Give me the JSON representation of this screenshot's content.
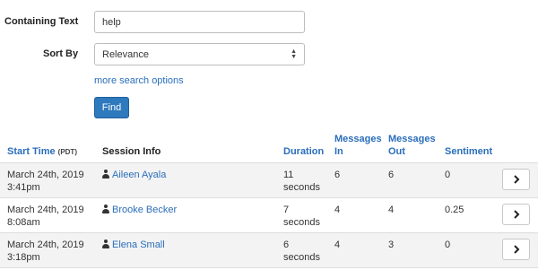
{
  "search": {
    "containing_text_label": "Containing Text",
    "containing_text_value": "help",
    "sort_by_label": "Sort By",
    "sort_by_value": "Relevance",
    "more_options_link": "more search options",
    "find_button": "Find"
  },
  "table": {
    "headers": {
      "start_time": "Start Time",
      "start_time_tz": "(PDT)",
      "session_info": "Session Info",
      "duration": "Duration",
      "messages_in_1": "Messages",
      "messages_in_2": "In",
      "messages_out_1": "Messages",
      "messages_out_2": "Out",
      "sentiment": "Sentiment"
    },
    "rows": [
      {
        "date": "March 24th, 2019",
        "time": "3:41pm",
        "user": "Aileen Ayala",
        "duration_num": "11",
        "duration_unit": "seconds",
        "messages_in": "6",
        "messages_out": "6",
        "sentiment": "0"
      },
      {
        "date": "March 24th, 2019",
        "time": "8:08am",
        "user": "Brooke Becker",
        "duration_num": "7",
        "duration_unit": "seconds",
        "messages_in": "4",
        "messages_out": "4",
        "sentiment": "0.25"
      },
      {
        "date": "March 24th, 2019",
        "time": "3:18pm",
        "user": "Elena Small",
        "duration_num": "6",
        "duration_unit": "seconds",
        "messages_in": "4",
        "messages_out": "3",
        "sentiment": "0"
      }
    ]
  },
  "icons": {
    "user": "user-icon",
    "row_action": "chevron-right-icon",
    "select": "sort-arrows-icon"
  },
  "colors": {
    "link": "#2a6ebb",
    "primary_button": "#2f79bd",
    "stripe": "#f3f3f3",
    "border": "#dddddd"
  }
}
